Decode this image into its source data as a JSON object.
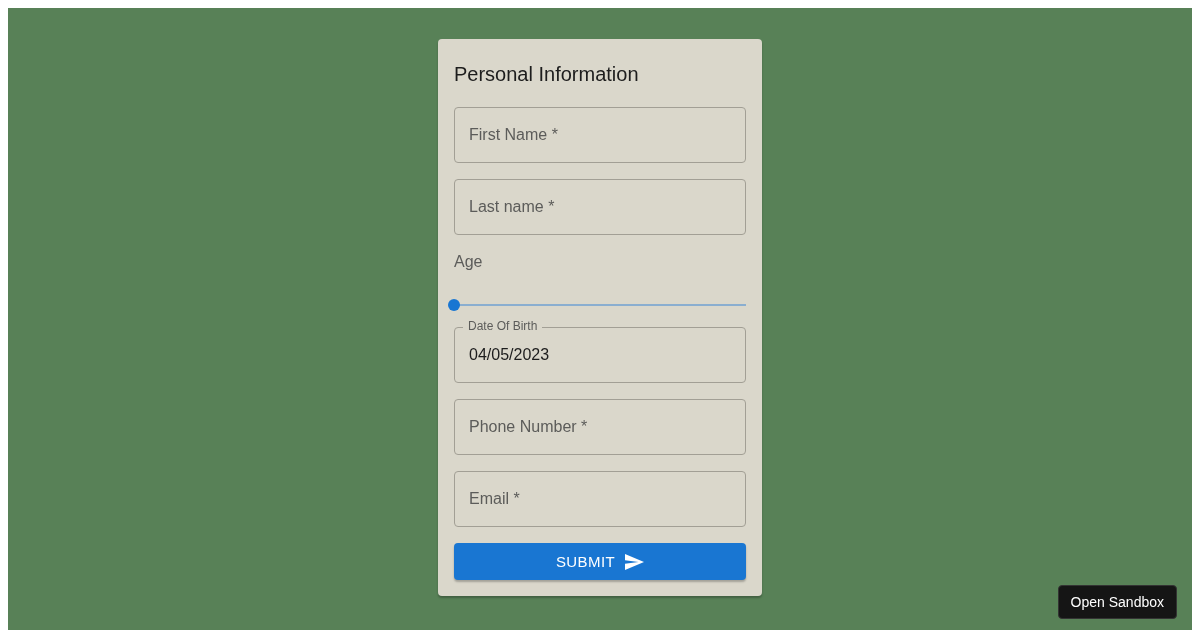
{
  "form": {
    "title": "Personal Information",
    "fields": [
      {
        "kind": "text",
        "placeholder": "First Name *"
      },
      {
        "kind": "text",
        "placeholder": "Last name *"
      },
      {
        "kind": "slider",
        "label": "Age",
        "level": 0
      },
      {
        "kind": "date",
        "label": "Date Of Birth",
        "value": "04/05/2023"
      },
      {
        "kind": "text",
        "placeholder": "Phone Number *"
      },
      {
        "kind": "text",
        "placeholder": "Email *"
      }
    ],
    "submit": "SUBMIT"
  },
  "sandbox_button": "Open Sandbox"
}
